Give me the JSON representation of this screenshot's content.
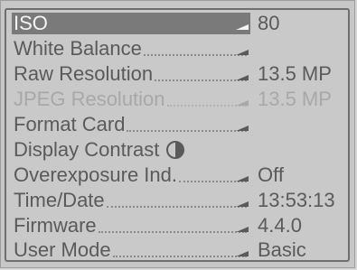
{
  "menu": {
    "items": [
      {
        "label": "ISO",
        "value": "80",
        "state": "selected"
      },
      {
        "label": "White Balance",
        "value": "",
        "state": "normal"
      },
      {
        "label": "Raw Resolution",
        "value": "13.5 MP",
        "state": "normal"
      },
      {
        "label": "JPEG Resolution",
        "value": "13.5 MP",
        "state": "disabled"
      },
      {
        "label": "Format Card",
        "value": "",
        "state": "normal"
      },
      {
        "label": "Display Contrast",
        "value": "",
        "state": "normal",
        "icon": "contrast-icon"
      },
      {
        "label": "Overexposure Ind.",
        "value": "Off",
        "state": "normal"
      },
      {
        "label": "Time/Date",
        "value": "13:53:13",
        "state": "normal"
      },
      {
        "label": "Firmware",
        "value": "4.4.0",
        "state": "normal"
      },
      {
        "label": "User Mode",
        "value": "Basic",
        "state": "normal"
      }
    ]
  }
}
